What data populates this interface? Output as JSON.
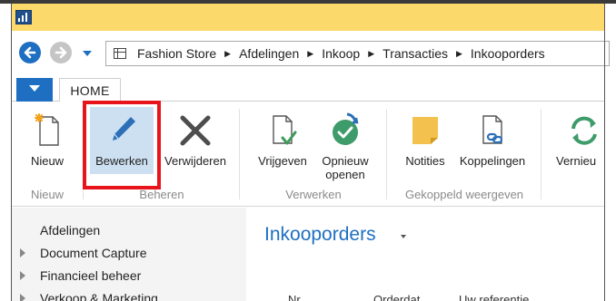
{
  "breadcrumb": [
    "Fashion Store",
    "Afdelingen",
    "Inkoop",
    "Transacties",
    "Inkooporders"
  ],
  "tabs": {
    "home": "HOME"
  },
  "ribbon": {
    "groups": [
      {
        "label": "Nieuw",
        "buttons": [
          {
            "label": "Nieuw",
            "icon": "new-document-icon"
          }
        ]
      },
      {
        "label": "Beheren",
        "buttons": [
          {
            "label": "Bewerken",
            "icon": "pencil-icon"
          },
          {
            "label": "Verwijderen",
            "icon": "delete-x-icon"
          }
        ]
      },
      {
        "label": "Verwerken",
        "buttons": [
          {
            "label": "Vrijgeven",
            "icon": "release-document-icon"
          },
          {
            "label": "Opnieuw openen",
            "icon": "reopen-icon"
          }
        ]
      },
      {
        "label": "Gekoppeld weergeven",
        "buttons": [
          {
            "label": "Notities",
            "icon": "note-icon"
          },
          {
            "label": "Koppelingen",
            "icon": "link-document-icon"
          }
        ]
      },
      {
        "label": "",
        "buttons": [
          {
            "label": "Vernieu",
            "icon": "refresh-icon"
          }
        ]
      }
    ]
  },
  "navpane": {
    "items": [
      "Afdelingen",
      "Document Capture",
      "Financieel beheer",
      "Verkoop & Marketing"
    ]
  },
  "main": {
    "title": "Inkooporders",
    "columns": [
      "Nr.",
      "Orderdat.",
      "Uw referentie"
    ]
  },
  "colors": {
    "accent": "#1e6fc2",
    "titlebar": "#fbd96b",
    "highlight": "#e8141c"
  }
}
